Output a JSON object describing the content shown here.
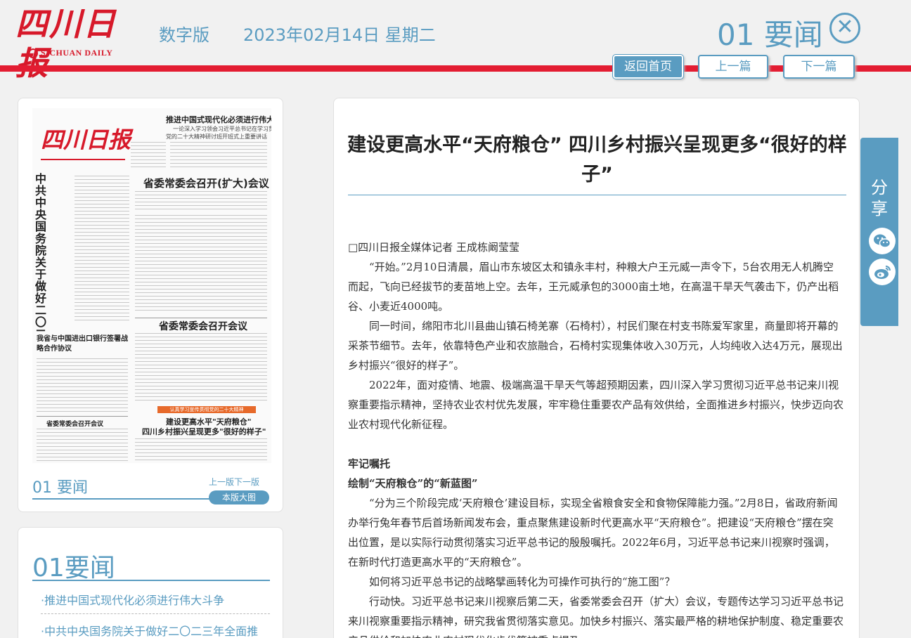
{
  "header": {
    "logo_cn": "四川日报",
    "logo_en": "SICHUAN DAILY",
    "edition": "数字版",
    "date": "2023年02月14日 星期二",
    "page_name": "01 要闻",
    "close_symbol": "✕",
    "nav": {
      "home": "返回首页",
      "prev": "上一篇",
      "next": "下一篇"
    },
    "colors": {
      "brand_red": "#e31d32",
      "accent_blue": "#5a9cc1"
    }
  },
  "thumbnail": {
    "paper": {
      "logo": "四川日报",
      "headline_top": "推进中国式现代化必须进行伟大斗争",
      "headline_top_sub1": "一论深入学习领会习近平总书记在学习贯彻",
      "headline_top_sub2": "党的二十大精神研讨班开班式上重要讲话",
      "vertical_title": "中共中央国务院关于做好二〇二三年全面推进乡村振兴重点工作的意见",
      "headline_1": "省委常委会召开(扩大)会议",
      "headline_2": "省委常委会召开会议",
      "headline_3": "我省与中国进出口银行签署战略合作协议",
      "headline_4": "省委常委会召开会议",
      "tag": "认真学习宣传贯彻党的二十大精神",
      "headline_5": "建设更高水平\"天府粮仓\"",
      "headline_5b": "四川乡村振兴呈现更多\"很好的样子\""
    },
    "page_name": "01 要闻",
    "prev_link": "上一版",
    "next_link": "下一版",
    "big_button": "本版大图"
  },
  "article_list": {
    "title": "01要闻",
    "items": [
      "·推进中国式现代化必须进行伟大斗争",
      "·中共中央国务院关于做好二〇二三年全面推"
    ]
  },
  "article": {
    "title": "建设更高水平“天府粮仓” 四川乡村振兴呈现更多“很好的样子”",
    "byline": "□四川日报全媒体记者 王成栋阚莹莹",
    "paragraphs": [
      "“开始。”2月10日清晨，眉山市东坡区太和镇永丰村，种粮大户王元威一声令下，5台农用无人机腾空而起，飞向已经拔节的麦苗地上空。去年，王元威承包的3000亩土地，在高温干旱天气袭击下，仍产出稻谷、小麦近4000吨。",
      "同一时间，绵阳市北川县曲山镇石椅羌寨（石椅村），村民们聚在村支书陈爱军家里，商量即将开幕的采茶节细节。去年，依靠特色产业和农旅融合，石椅村实现集体收入30万元，人均纯收入达4万元，展现出乡村振兴“很好的样子”。",
      "2022年，面对疫情、地震、极端高温干旱天气等超预期因素，四川深入学习贯彻习近平总书记来川视察重要指示精神，坚持农业农村优先发展，牢牢稳住重要农产品有效供给，全面推进乡村振兴，快步迈向农业农村现代化新征程。"
    ],
    "section_title_1": "牢记嘱托",
    "section_title_2": "绘制“天府粮仓”的“新蓝图”",
    "paragraphs_2": [
      "“分为三个阶段完成‘天府粮仓’建设目标，实现全省粮食安全和食物保障能力强。”2月8日，省政府新闻办举行兔年春节后首场新闻发布会，重点聚焦建设新时代更高水平“天府粮仓”。把建设“天府粮仓”摆在突出位置，是以实际行动贯彻落实习近平总书记的殷殷嘱托。2022年6月，习近平总书记来川视察时强调，在新时代打造更高水平的“天府粮仓”。",
      "如何将习近平总书记的战略擘画转化为可操作可执行的“施工图”？",
      "行动快。习近平总书记来川视察后第二天，省委常委会召开（扩大）会议，专题传达学习习近平总书记来川视察重要指示精神，研究我省贯彻落实意见。加快乡村振兴、落实最严格的耕地保护制度、稳定重要农产品供给和加快农业农村现代化步伐等被重点提及。"
    ]
  },
  "share": {
    "label": "分享",
    "icons": [
      "wechat-icon",
      "weibo-icon"
    ]
  }
}
